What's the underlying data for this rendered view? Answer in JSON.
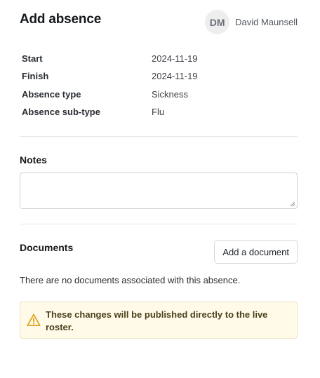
{
  "header": {
    "title": "Add absence",
    "user_initials": "DM",
    "user_name": "David Maunsell"
  },
  "details": [
    {
      "label": "Start",
      "value": "2024-11-19"
    },
    {
      "label": "Finish",
      "value": "2024-11-19"
    },
    {
      "label": "Absence type",
      "value": "Sickness"
    },
    {
      "label": "Absence sub-type",
      "value": "Flu"
    }
  ],
  "notes": {
    "title": "Notes",
    "value": "",
    "placeholder": ""
  },
  "documents": {
    "title": "Documents",
    "add_button_label": "Add a document",
    "empty_message": "There are no documents associated with this absence."
  },
  "warning": {
    "icon": "warning-triangle-icon",
    "message": "These changes will be published directly to the live roster.",
    "color": "#e0a11b",
    "background": "#fffbe8"
  }
}
